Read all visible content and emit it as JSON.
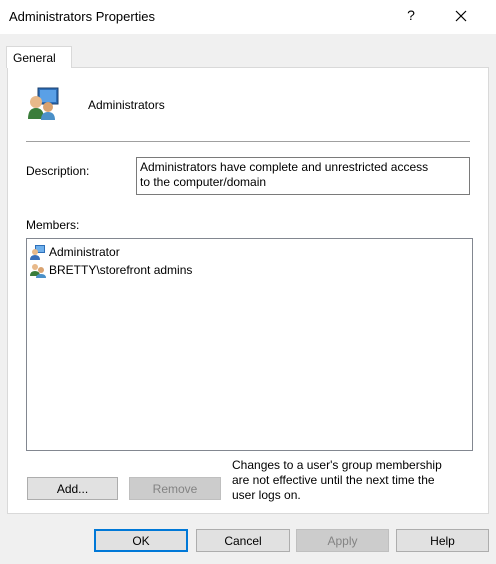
{
  "window": {
    "title": "Administrators Properties",
    "help_glyph": "?"
  },
  "tabs": [
    {
      "label": "General"
    }
  ],
  "group": {
    "name": "Administrators",
    "icon": "group-icon"
  },
  "description": {
    "label": "Description:",
    "value_line1": "Administrators have complete and unrestricted access",
    "value_line2": "to the computer/domain"
  },
  "members": {
    "label": "Members:",
    "items": [
      {
        "name": "Administrator",
        "icon": "user-icon"
      },
      {
        "name": "BRETTY\\storefront admins",
        "icon": "group-icon"
      }
    ]
  },
  "buttons": {
    "add": "Add...",
    "remove": "Remove",
    "ok": "OK",
    "cancel": "Cancel",
    "apply": "Apply",
    "help": "Help"
  },
  "note": {
    "line1": "Changes to a user's group membership",
    "line2": "are not effective until the next time the",
    "line3": "user logs on."
  },
  "colors": {
    "accent": "#0078d7",
    "window_bg": "#f0f0f0",
    "panel_bg": "#ffffff"
  }
}
